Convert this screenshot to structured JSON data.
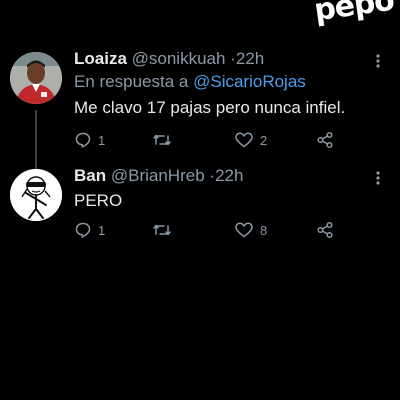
{
  "watermark": "pepo",
  "tweets": [
    {
      "name": "Loaiza",
      "handle": "@sonikkuah",
      "separator": "·",
      "time": "22h",
      "reply_prefix": "En respuesta a",
      "reply_mention": "@SicarioRojas",
      "text": "Me clavo 17 pajas pero nunca infiel.",
      "replies": "1",
      "retweets": "",
      "likes": "2",
      "avatar_icon": "profile-photo-red-jersey"
    },
    {
      "name": "Ban",
      "handle": "@BrianHreb",
      "separator": "·",
      "time": "22h",
      "text": "PERO",
      "replies": "1",
      "retweets": "",
      "likes": "8",
      "avatar_icon": "cartoon-character-sunglasses"
    }
  ],
  "colors": {
    "background": "#000000",
    "text": "#e7e9ea",
    "muted": "#8b98a5",
    "mention": "#4a9fe8",
    "thread_line": "#3d4146"
  }
}
